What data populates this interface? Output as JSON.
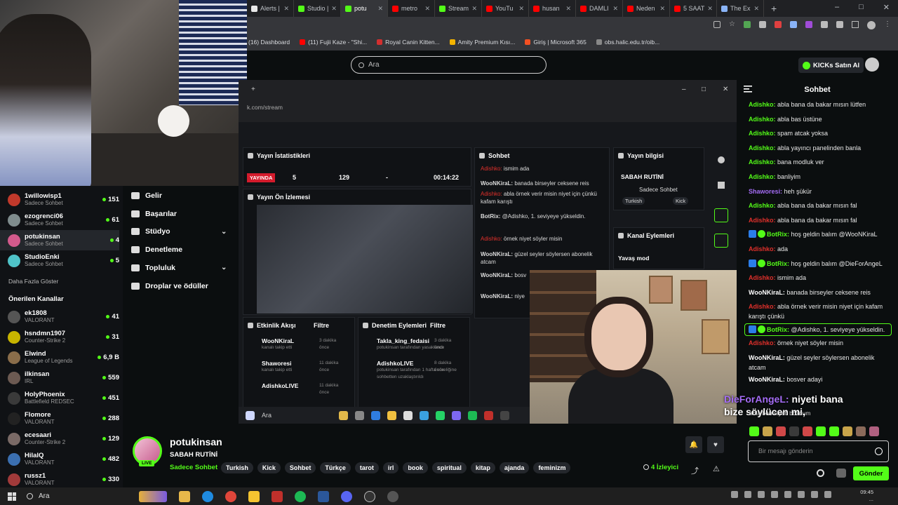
{
  "browser": {
    "tabs": [
      {
        "label": "Alerts |",
        "color": "#e8e8e8"
      },
      {
        "label": "Studio |",
        "color": "#53fc18"
      },
      {
        "label": "potu",
        "color": "#53fc18",
        "active": true
      },
      {
        "label": "metro",
        "color": "#ff0000"
      },
      {
        "label": "Stream",
        "color": "#53fc18"
      },
      {
        "label": "YouTu",
        "color": "#ff0000"
      },
      {
        "label": "husan",
        "color": "#ff0000"
      },
      {
        "label": "DAMLI",
        "color": "#ff0000"
      },
      {
        "label": "Neden",
        "color": "#ff0000"
      },
      {
        "label": "5 SAAT",
        "color": "#ff0000"
      },
      {
        "label": "The Ex",
        "color": "#8ab4f8"
      }
    ],
    "new_tab": "+",
    "bookmarks": [
      {
        "label": "(16) Dashboard",
        "color": ""
      },
      {
        "label": "(11) Fujii Kaze - \"Shi...",
        "color": "#ff0000"
      },
      {
        "label": "Royal Canin Kitten...",
        "color": "#d32f2f"
      },
      {
        "label": "Amity Premium Kısı...",
        "color": "#f4b400"
      },
      {
        "label": "Giriş | Microsoft 365",
        "color": "#f25022"
      },
      {
        "label": "obs.halic.edu.tr/oib...",
        "color": "#888888"
      }
    ]
  },
  "kick": {
    "search_placeholder": "Ara",
    "buy_kicks": "KICKs Satın Al"
  },
  "sidebar": {
    "following": [
      {
        "name": "1willowisp1",
        "sub": "Sadece Sohbet",
        "count": "151",
        "color": "#c0392b"
      },
      {
        "name": "ezogrenci06",
        "sub": "Sadece Sohbet",
        "count": "61",
        "color": "#7f8c8d"
      },
      {
        "name": "potukinsan",
        "sub": "Sadece Sohbet",
        "count": "4",
        "color": "#d35a8c",
        "selected": true
      },
      {
        "name": "StudioEnki",
        "sub": "Sadece Sohbet",
        "count": "5",
        "color": "#4fc3c8"
      }
    ],
    "show_more": "Daha Fazla Göster",
    "recommended_title": "Önerilen Kanallar",
    "recommended": [
      {
        "name": "ek1808",
        "sub": "VALORANT",
        "count": "41",
        "color": "#555555"
      },
      {
        "name": "hsndmn1907",
        "sub": "Counter-Strike 2",
        "count": "31",
        "color": "#c8b400"
      },
      {
        "name": "Elwind",
        "sub": "League of Legends",
        "count": "6,9 B",
        "color": "#8a6d4a"
      },
      {
        "name": "ilkinsan",
        "sub": "IRL",
        "count": "559",
        "color": "#6c5a52"
      },
      {
        "name": "HolyPhoenix",
        "sub": "Battlefield REDSEC",
        "count": "451",
        "color": "#3a3a3a"
      },
      {
        "name": "Flomore",
        "sub": "VALORANT",
        "count": "288",
        "color": "#222222"
      },
      {
        "name": "ecesaari",
        "sub": "Counter-Strike 2",
        "count": "129",
        "color": "#7a6a66"
      },
      {
        "name": "HilalQ",
        "sub": "VALORANT",
        "count": "482",
        "color": "#3b6fb0"
      },
      {
        "name": "russz1",
        "sub": "VALORANT",
        "count": "330",
        "color": "#a13a3a"
      }
    ]
  },
  "dashboard_menu": [
    {
      "label": "Gelir",
      "chevron": false
    },
    {
      "label": "Başarılar",
      "chevron": false
    },
    {
      "label": "Stüdyo",
      "chevron": true
    },
    {
      "label": "Denetleme",
      "chevron": false
    },
    {
      "label": "Topluluk",
      "chevron": true
    },
    {
      "label": "Droplar ve ödüller",
      "chevron": false
    }
  ],
  "capture": {
    "url": "k.com/stream",
    "stats_title": "Yayın İstatistikleri",
    "live": "YAYINDA",
    "stats": [
      "5",
      "129",
      "-",
      "00:14:22"
    ],
    "preview_title": "Yayın Ön İzlemesi",
    "chat_title": "Sohbet",
    "info_title": "Yayın bilgisi",
    "info_stream_title": "SABAH RUTİNİ",
    "info_category": "Sadece Sohbet",
    "info_tags": [
      "Turkish",
      "Kick"
    ],
    "actions_title": "Kanal Eylemleri",
    "slow_mode": "Yavaş mod",
    "activity_title": "Etkinlik Akışı",
    "moderation_title": "Denetim Eylemleri",
    "filter": "Filtre",
    "chat": [
      {
        "user": "Adishko:",
        "text": "ismim ada",
        "red": true
      },
      {
        "user": "WooNKiraL:",
        "text": "banada birseyler ceksene reis",
        "red": false
      },
      {
        "user": "Adishko:",
        "text": "abla örnek verir misin niyet için çünkü kafam karıştı",
        "red": true
      },
      {
        "user": "BotRix:",
        "text": "@Adishko, 1. seviyeye yükseldin.",
        "red": false
      },
      {
        "user": "Adishko:",
        "text": "örnek niyet söyler misin",
        "red": true
      },
      {
        "user": "WooNKiraL:",
        "text": "güzel seyler söylersen abonelik atcam",
        "red": false
      },
      {
        "user": "WooNKiraL:",
        "text": "bosv",
        "red": false
      },
      {
        "user": "WooNKiraL:",
        "text": "niye",
        "red": false
      }
    ],
    "activity": [
      {
        "user": "WooNKiraL",
        "desc": "kanalı takip etti",
        "time": "3 dakika önce"
      },
      {
        "user": "Shaworesi",
        "desc": "kanalı takip etti",
        "time": "11 dakika önce"
      },
      {
        "user": "AdishkoLIVE",
        "desc": "",
        "time": "11 dakika önce"
      }
    ],
    "moderation": [
      {
        "user": "Takla_king_fedaisi",
        "desc": "potukinsan tarafından yasaklandı",
        "time": "3 dakika önce"
      },
      {
        "user": "AdishkoLIVE",
        "desc": "potukinsan tarafından 1 hafta süreliğine sohbetten uzaklaştırıldı",
        "time": "8 dakika önce"
      }
    ],
    "taskbar_search": "Ara"
  },
  "chat": {
    "title": "Sohbet",
    "messages": [
      {
        "user": "Adishko:",
        "text": "abla bana da bakar mısın lütfen",
        "color": "#53fc18"
      },
      {
        "user": "Adishko:",
        "text": "abla bas üstüne",
        "color": "#53fc18"
      },
      {
        "user": "Adishko:",
        "text": "spam atcak yoksa",
        "color": "#53fc18"
      },
      {
        "user": "Adishko:",
        "text": "abla yayıncı panelinden banla",
        "color": "#53fc18"
      },
      {
        "user": "Adishko:",
        "text": "bana modluk ver",
        "color": "#53fc18"
      },
      {
        "user": "Adishko:",
        "text": "banliyim",
        "color": "#53fc18"
      },
      {
        "user": "Shaworesi:",
        "text": "heh şükür",
        "color": "#a46cf5"
      },
      {
        "user": "Adishko:",
        "text": "abla bana da bakar mısın fal",
        "color": "#53fc18"
      },
      {
        "user": "Adishko:",
        "text": "abla bana da bakar mısın fal",
        "color": "#e0302b"
      },
      {
        "user": "BotRix:",
        "text": "hoş geldin balım @WooNKiraL",
        "color": "#53fc18",
        "bot": true
      },
      {
        "user": "Adishko:",
        "text": "ada",
        "color": "#e0302b"
      },
      {
        "user": "BotRix:",
        "text": "hoş geldin balım @DieForAngeL",
        "color": "#53fc18",
        "bot": true
      },
      {
        "user": "Adishko:",
        "text": "ismim ada",
        "color": "#e0302b"
      },
      {
        "user": "WooNKiraL:",
        "text": "banada birseyler ceksene reis",
        "color": "#ffffff"
      },
      {
        "user": "Adishko:",
        "text": "abla örnek verir misin niyet için kafam karıştı çünkü",
        "color": "#e0302b"
      },
      {
        "user": "BotRix:",
        "text": "@Adishko, 1. seviyeye yükseldin.",
        "color": "#53fc18",
        "bot": true,
        "highlight": true
      },
      {
        "user": "Adishko:",
        "text": "örnek niyet söyler misin",
        "color": "#e0302b"
      },
      {
        "user": "WooNKiraL:",
        "text": "güzel seyler söylersen abonelik atcam",
        "color": "#ffffff"
      },
      {
        "user": "WooNKiraL:",
        "text": "bosver adayi",
        "color": "#ffffff"
      }
    ],
    "overlay_user": "DieForAngeL:",
    "overlay_text1": "niyeti bana",
    "overlay_text2": "bize söylücen mi,",
    "partial_line": "abla ben niyeti bozdum",
    "input_placeholder": "Bir mesajı gönderin",
    "send": "Gönder"
  },
  "channel": {
    "name": "potukinsan",
    "live": "LIVE",
    "title": "SABAH RUTİNİ",
    "category": "Sadece Sohbet",
    "tags": [
      "Turkish",
      "Kick",
      "Sohbet",
      "Türkçe",
      "tarot",
      "irl",
      "book",
      "spiritual",
      "kitap",
      "ajanda",
      "feminizm"
    ],
    "viewers": "4 İzleyici"
  },
  "taskbar": {
    "search": "Ara",
    "time": "09:45",
    "date": "..."
  }
}
